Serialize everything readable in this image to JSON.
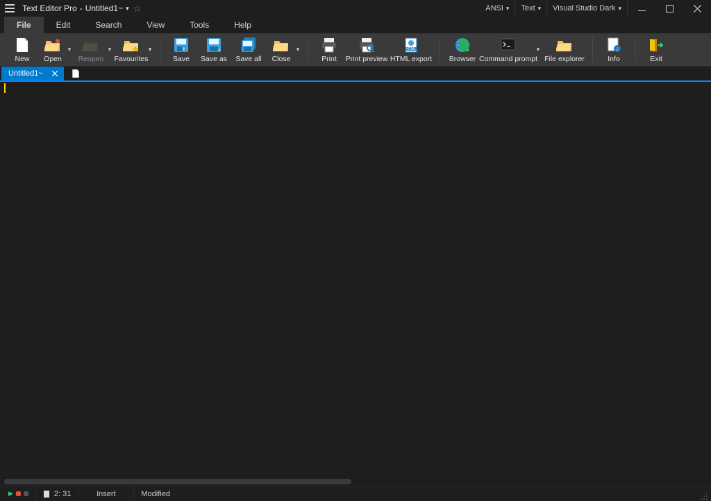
{
  "title": {
    "app": "Text Editor Pro",
    "sep": "  -  ",
    "doc": "Untitled1~"
  },
  "title_dropdowns": {
    "encoding": "ANSI",
    "filetype": "Text",
    "theme": "Visual Studio Dark"
  },
  "menu": [
    "File",
    "Edit",
    "Search",
    "View",
    "Tools",
    "Help"
  ],
  "active_menu_index": 0,
  "ribbon": {
    "new": "New",
    "open": "Open",
    "reopen": "Reopen",
    "favourites": "Favourites",
    "save": "Save",
    "saveas": "Save as",
    "saveall": "Save all",
    "close": "Close",
    "print": "Print",
    "printpreview": "Print preview",
    "htmlexport": "HTML export",
    "browser": "Browser",
    "commandprompt": "Command prompt",
    "fileexplorer": "File explorer",
    "info": "Info",
    "exit": "Exit"
  },
  "tabs": [
    {
      "label": "Untitled1~"
    }
  ],
  "status": {
    "cursor": "2: 31",
    "mode": "Insert",
    "modified": "Modified"
  }
}
